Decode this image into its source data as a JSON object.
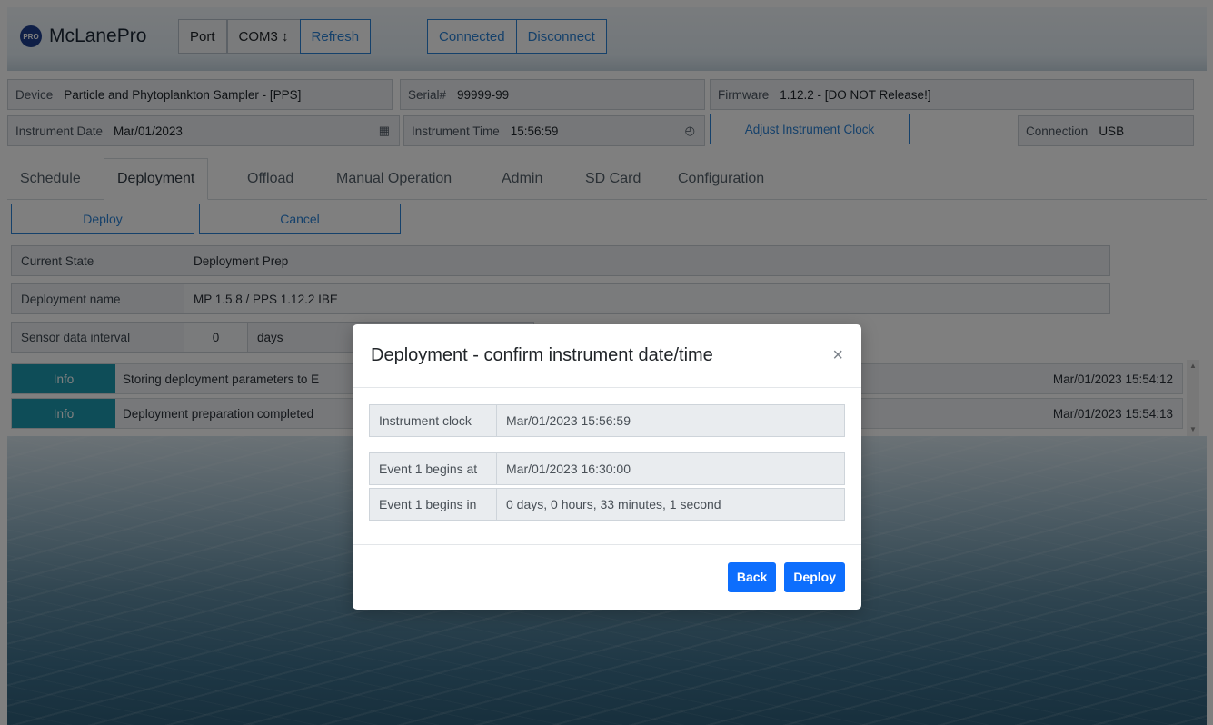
{
  "app": {
    "logo_badge": "PRO",
    "name": "McLanePro"
  },
  "toolbar": {
    "port_label": "Port",
    "port_value": "COM3 ↕",
    "refresh_label": "Refresh",
    "connected_label": "Connected",
    "disconnect_label": "Disconnect"
  },
  "device": {
    "device_label": "Device",
    "device_value": "Particle and Phytoplankton Sampler - [PPS]",
    "serial_label": "Serial#",
    "serial_value": "99999-99",
    "firmware_label": "Firmware",
    "firmware_value": "1.12.2 - [DO NOT Release!]",
    "date_label": "Instrument Date",
    "date_value": "Mar/01/2023",
    "time_label": "Instrument Time",
    "time_value": "15:56:59",
    "adjust_clock_label": "Adjust Instrument Clock",
    "connection_label": "Connection",
    "connection_value": "USB"
  },
  "tabs": [
    {
      "label": "Schedule"
    },
    {
      "label": "Deployment"
    },
    {
      "label": "Offload"
    },
    {
      "label": "Manual Operation"
    },
    {
      "label": "Admin"
    },
    {
      "label": "SD Card"
    },
    {
      "label": "Configuration"
    }
  ],
  "actions": {
    "deploy_label": "Deploy",
    "cancel_label": "Cancel"
  },
  "deployment": {
    "state_label": "Current State",
    "state_value": "Deployment Prep",
    "name_label": "Deployment name",
    "name_value": "MP 1.5.8 / PPS 1.12.2 IBE",
    "interval_label": "Sensor data interval",
    "interval_value": "0",
    "interval_unit": "days"
  },
  "log": [
    {
      "tag": "Info",
      "message": "Storing deployment parameters to E",
      "time": "Mar/01/2023 15:54:12"
    },
    {
      "tag": "Info",
      "message": "Deployment preparation completed",
      "time": "Mar/01/2023 15:54:13"
    }
  ],
  "modal": {
    "title": "Deployment - confirm instrument date/time",
    "close_glyph": "×",
    "rows": [
      {
        "label": "Instrument clock",
        "value": "Mar/01/2023 15:56:59"
      },
      {
        "label": "Event 1 begins at",
        "value": "Mar/01/2023 16:30:00"
      },
      {
        "label": "Event 1 begins in",
        "value": "0 days, 0 hours, 33 minutes, 1 second"
      }
    ],
    "back_label": "Back",
    "deploy_label": "Deploy"
  },
  "colors": {
    "accent": "#0d6efd",
    "outline_blue": "#2b82d6",
    "info_tag": "#1d9bb0"
  }
}
